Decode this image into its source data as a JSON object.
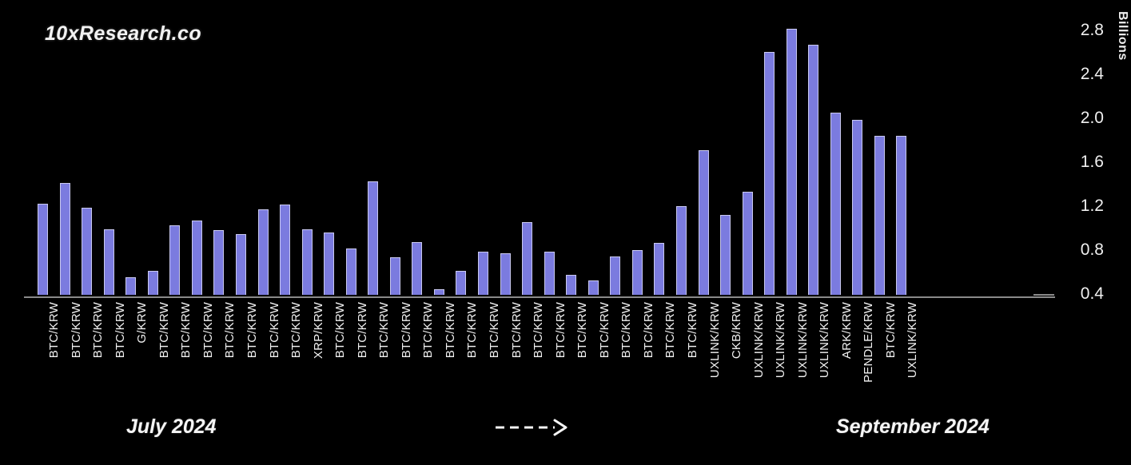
{
  "watermark": "10xResearch.co",
  "annotations": {
    "left_period": "July 2024",
    "right_period": "September 2024",
    "arrow": "----->"
  },
  "axis": {
    "y_title": "Billions",
    "y_ticks": [
      "0.4",
      "0.8",
      "1.2",
      "1.6",
      "2.0",
      "2.4",
      "2.8"
    ]
  },
  "chart_data": {
    "type": "bar",
    "title": "",
    "subtitle": "",
    "xlabel": "",
    "ylabel": "Billions",
    "ylim": [
      0.4,
      2.8
    ],
    "ytick_values": [
      0.4,
      0.8,
      1.2,
      1.6,
      2.0,
      2.4,
      2.8
    ],
    "grid": false,
    "legend": null,
    "bar_color": "#7b7bdf",
    "bar_edge_color": "#c9c9ef",
    "background_color": "#000000",
    "text_color": "#f2f2f2",
    "note": "Y axis is truncated: bar baseline sits at 0.4 Billions.",
    "categories": [
      "BTC/KRW",
      "BTC/KRW",
      "BTC/KRW",
      "BTC/KRW",
      "G/KRW",
      "BTC/KRW",
      "BTC/KRW",
      "BTC/KRW",
      "BTC/KRW",
      "BTC/KRW",
      "BTC/KRW",
      "BTC/KRW",
      "XRP/KRW",
      "BTC/KRW",
      "BTC/KRW",
      "BTC/KRW",
      "BTC/KRW",
      "BTC/KRW",
      "BTC/KRW",
      "BTC/KRW",
      "BTC/KRW",
      "BTC/KRW",
      "BTC/KRW",
      "BTC/KRW",
      "BTC/KRW",
      "BTC/KRW",
      "BTC/KRW",
      "BTC/KRW",
      "BTC/KRW",
      "BTC/KRW",
      "UXLINK/KRW",
      "CKB/KRW",
      "UXLINK/KRW",
      "UXLINK/KRW",
      "UXLINK/KRW",
      "UXLINK/KRW",
      "ARK/KRW",
      "PENDLE/KRW",
      "BTC/KRW",
      "UXLINK/KRW"
    ],
    "values": [
      1.23,
      1.42,
      1.19,
      1.0,
      0.56,
      0.62,
      1.03,
      1.08,
      0.99,
      0.95,
      1.18,
      1.22,
      1.0,
      0.97,
      0.82,
      1.43,
      0.74,
      0.88,
      0.45,
      0.62,
      0.79,
      0.78,
      1.06,
      0.79,
      0.58,
      0.53,
      0.75,
      0.81,
      0.87,
      1.21,
      1.72,
      1.13,
      1.34,
      2.61,
      2.82,
      2.68,
      2.06,
      1.99,
      1.85,
      1.85
    ]
  }
}
